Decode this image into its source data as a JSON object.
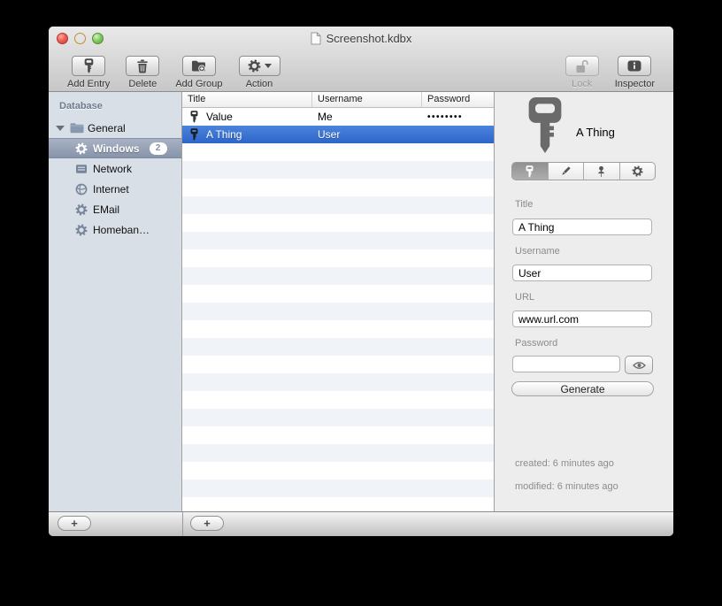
{
  "window": {
    "title": "Screenshot.kdbx"
  },
  "toolbar": {
    "buttons": [
      {
        "label": "Add Entry",
        "icon": "key"
      },
      {
        "label": "Delete",
        "icon": "trash"
      },
      {
        "label": "Add Group",
        "icon": "folder-plus"
      },
      {
        "label": "Action",
        "icon": "gear-with-caret"
      }
    ],
    "right_buttons": [
      {
        "label": "Lock",
        "icon": "open-padlock",
        "disabled": true
      },
      {
        "label": "Inspector",
        "icon": "info"
      }
    ]
  },
  "sidebar": {
    "header": "Database",
    "group": {
      "label": "General",
      "icon": "folder",
      "expanded": true
    },
    "items": [
      {
        "label": "Windows",
        "icon": "gear",
        "badge": "2",
        "selected": true
      },
      {
        "label": "Network",
        "icon": "network-box",
        "selected": false
      },
      {
        "label": "Internet",
        "icon": "globe",
        "selected": false
      },
      {
        "label": "EMail",
        "icon": "gear",
        "selected": false
      },
      {
        "label": "Homeban…",
        "icon": "gear",
        "selected": false
      }
    ]
  },
  "table": {
    "columns": [
      "Title",
      "Username",
      "Password"
    ],
    "rows": [
      {
        "icon": "key",
        "title": "Value",
        "username": "Me",
        "password": "••••••••",
        "selected": false
      },
      {
        "icon": "key",
        "title": "A Thing",
        "username": "User",
        "password": "",
        "selected": true
      }
    ]
  },
  "inspector": {
    "entry_icon": "key",
    "entry_title": "A Thing",
    "tabs": [
      "key",
      "pencil",
      "pushpin",
      "gear"
    ],
    "selected_tab": "key",
    "fields": [
      {
        "label": "Title",
        "value": "A Thing"
      },
      {
        "label": "Username",
        "value": "User"
      },
      {
        "label": "URL",
        "value": "www.url.com"
      },
      {
        "label": "Password",
        "value": "",
        "eye_icon": "eye"
      }
    ],
    "generate_label": "Generate",
    "created": "created: 6 minutes ago",
    "modified": "modified: 6 minutes ago"
  },
  "bottom_bar": {
    "add_group_label": "+",
    "add_entry_label": "+"
  },
  "colors": {
    "selection_blue": "#3b74d3",
    "sidebar_selection": "#97a3b8",
    "sidebar_bg": "#d9dfe7",
    "table_stripe": "#f0f4f9",
    "inspector_bg": "#ededed",
    "chrome_top": "#e9e9e9",
    "chrome_bottom": "#c7c7c7"
  }
}
